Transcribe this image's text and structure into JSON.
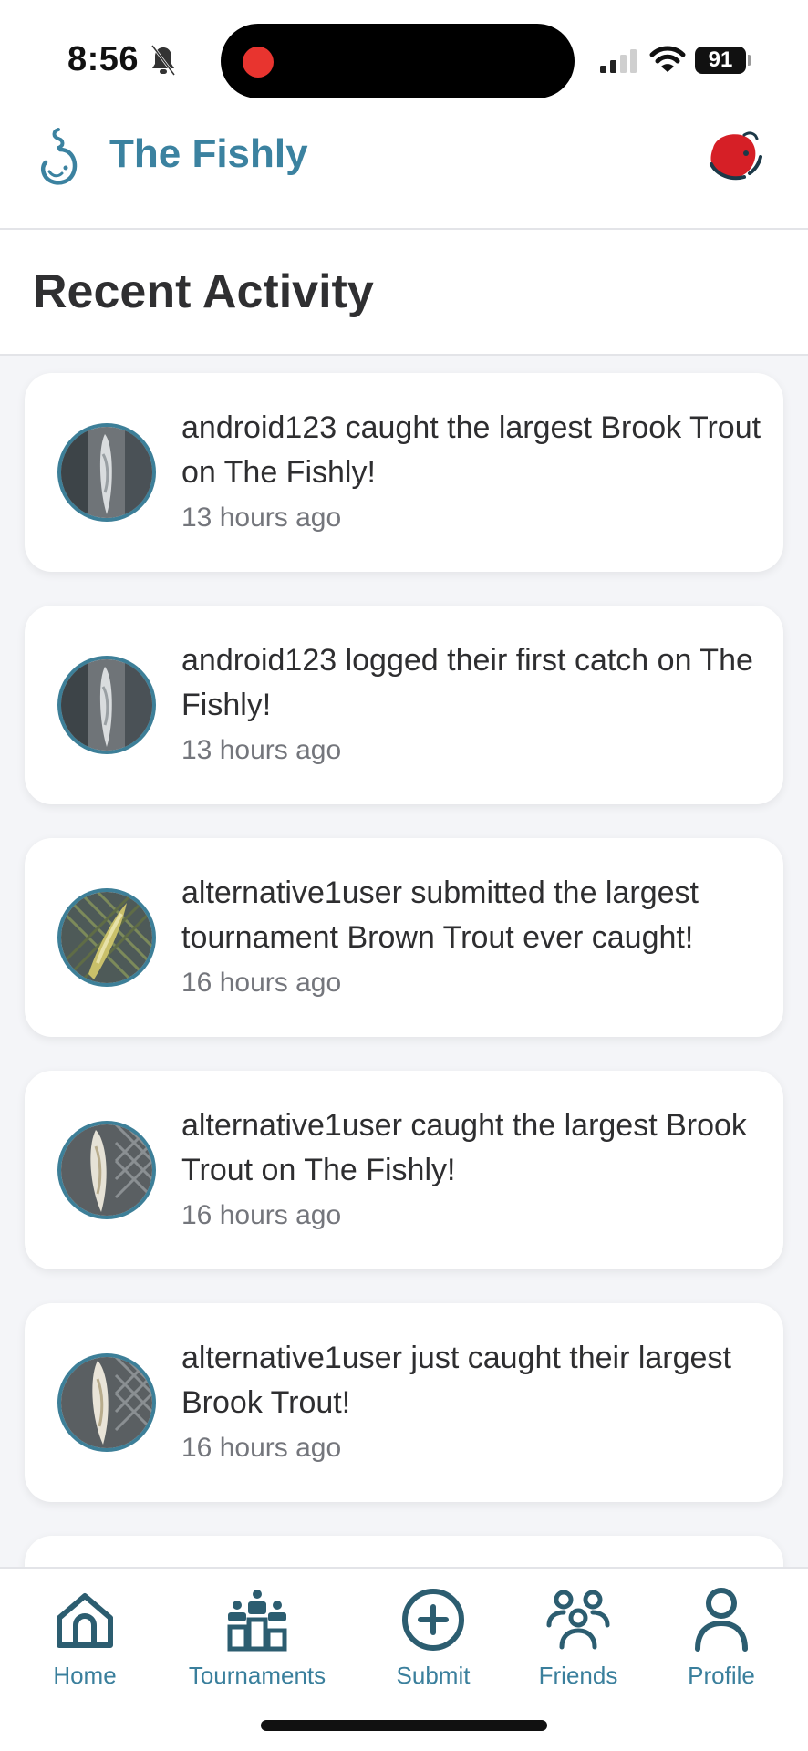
{
  "status_bar": {
    "time": "8:56",
    "battery": "91",
    "icons": [
      "bell-muted-icon",
      "signal-icon",
      "wifi-icon",
      "battery-icon"
    ]
  },
  "header": {
    "title": "The Fishly",
    "logo_icon": "fish-hook-logo-icon",
    "right_icon": "fishly-mascot-icon"
  },
  "section": {
    "title": "Recent Activity"
  },
  "activities": [
    {
      "text": "android123 caught the largest Brook Trout on The Fishly!",
      "time": "13 hours ago"
    },
    {
      "text": "android123 logged their first catch on The Fishly!",
      "time": "13 hours ago"
    },
    {
      "text": "alternative1user submitted the largest tournament Brown Trout ever caught!",
      "time": "16 hours ago"
    },
    {
      "text": "alternative1user caught the largest Brook Trout on The Fishly!",
      "time": "16 hours ago"
    },
    {
      "text": "alternative1user just caught their largest Brook Trout!",
      "time": "16 hours ago"
    }
  ],
  "nav": {
    "items": [
      {
        "label": "Home",
        "icon": "home-icon"
      },
      {
        "label": "Tournaments",
        "icon": "tournaments-icon"
      },
      {
        "label": "Submit",
        "icon": "plus-circle-icon"
      },
      {
        "label": "Friends",
        "icon": "friends-icon"
      },
      {
        "label": "Profile",
        "icon": "profile-icon"
      }
    ]
  },
  "colors": {
    "accent": "#3b82a0",
    "background": "#f4f5f8",
    "card": "#ffffff",
    "avatar_border": "#3d7f98"
  }
}
